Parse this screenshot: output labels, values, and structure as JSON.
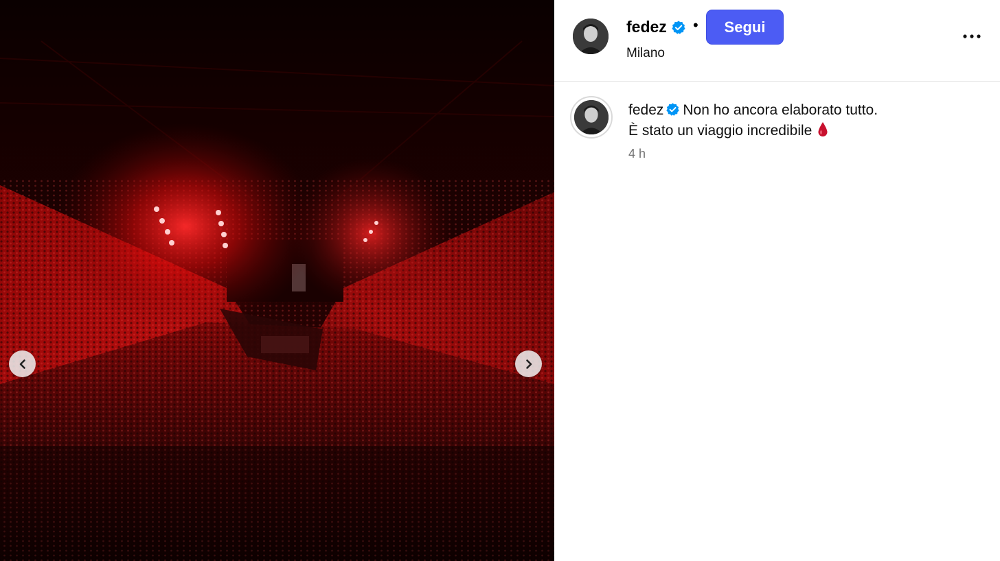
{
  "media": {
    "description_icon": "concert-arena-photo",
    "prev_icon": "chevron-left-icon",
    "next_icon": "chevron-right-icon"
  },
  "header": {
    "username": "fedez",
    "verified": true,
    "separator": "•",
    "follow_label": "Segui",
    "location": "Milano",
    "more_icon": "more-horizontal-icon"
  },
  "caption": {
    "username": "fedez",
    "line1": "Non ho ancora elaborato tutto.",
    "line2": "È stato un viaggio incredibile",
    "emoji": "drop-of-blood-icon",
    "timestamp": "4 h"
  },
  "colors": {
    "follow_button": "#4c5cf4",
    "verified_badge": "#0095f6",
    "stage_light": "#ff1a1a",
    "timestamp": "#737373"
  }
}
